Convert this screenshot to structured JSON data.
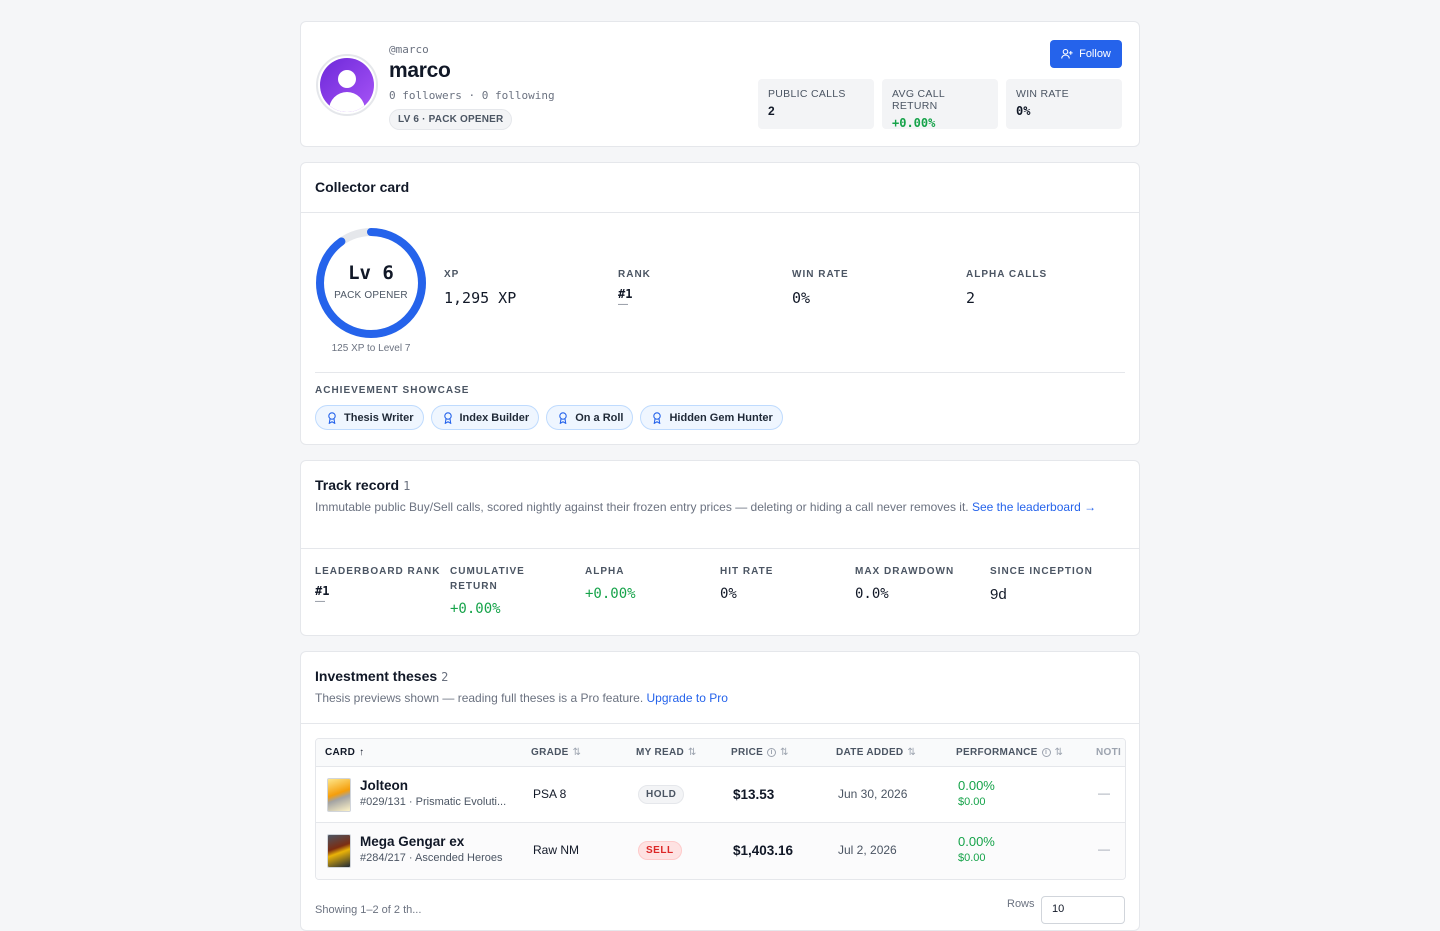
{
  "profile": {
    "handle": "@marco",
    "name": "marco",
    "follows": "0 followers · 0 following",
    "level_badge": "LV 6 · PACK OPENER",
    "follow_label": "Follow",
    "stats": [
      {
        "label": "PUBLIC CALLS",
        "value": "2"
      },
      {
        "label": "AVG CALL RETURN",
        "value": "+0.00%"
      },
      {
        "label": "WIN RATE",
        "value": "0%"
      }
    ]
  },
  "collector": {
    "title": "Collector card",
    "level": "Lv 6",
    "tier": "PACK OPENER",
    "progress_fraction": 0.9,
    "progress_note": "125 XP to Level 7",
    "stats": {
      "xp_label": "XP",
      "xp_value": "1,295 XP",
      "rank_label": "RANK",
      "rank_value": "#1",
      "rank_sub": "—",
      "winrate_label": "WIN RATE",
      "winrate_value": "0%",
      "alpha_label": "ALPHA CALLS",
      "alpha_value": "2"
    },
    "achievements_title": "ACHIEVEMENT SHOWCASE",
    "achievements": [
      "Thesis Writer",
      "Index Builder",
      "On a Roll",
      "Hidden Gem Hunter"
    ]
  },
  "track": {
    "title": "Track record",
    "count": "1",
    "description": "Immutable public Buy/Sell calls, scored nightly against their frozen entry prices — deleting or hiding a call never removes it.",
    "link": "See the leaderboard →",
    "stats": {
      "rank_label": "LEADERBOARD RANK",
      "rank_value": "#1",
      "rank_sub": "—",
      "cum_label": "CUMULATIVE RETURN",
      "cum_value": "+0.00%",
      "alpha_label": "ALPHA",
      "alpha_value": "+0.00%",
      "hit_label": "HIT RATE",
      "hit_value": "0%",
      "dd_label": "MAX DRAWDOWN",
      "dd_value": "0.0%",
      "since_label": "SINCE INCEPTION",
      "since_value": "9d"
    }
  },
  "theses": {
    "title": "Investment theses",
    "count": "2",
    "description": "Thesis previews shown — reading full theses is a Pro feature.",
    "link": "Upgrade to Pro",
    "columns": {
      "card": "CARD",
      "grade": "GRADE",
      "read": "MY READ",
      "price": "PRICE",
      "date": "DATE ADDED",
      "perf": "PERFORMANCE",
      "notes": "NOTI"
    },
    "rows": [
      {
        "name": "Jolteon",
        "sub": "#029/131 · Prismatic Evoluti...",
        "grade": "PSA 8",
        "read": "HOLD",
        "price": "$13.53",
        "date": "Jun 30, 2026",
        "perf_pct": "0.00%",
        "perf_usd": "$0.00",
        "note": "—"
      },
      {
        "name": "Mega Gengar ex",
        "sub": "#284/217 · Ascended Heroes",
        "grade": "Raw NM",
        "read": "SELL",
        "price": "$1,403.16",
        "date": "Jul 2, 2026",
        "perf_pct": "0.00%",
        "perf_usd": "$0.00",
        "note": "—"
      }
    ],
    "footer_left": "Showing 1–2 of 2 th...",
    "footer_rows_label": "Rows",
    "footer_rows_value": "10"
  }
}
